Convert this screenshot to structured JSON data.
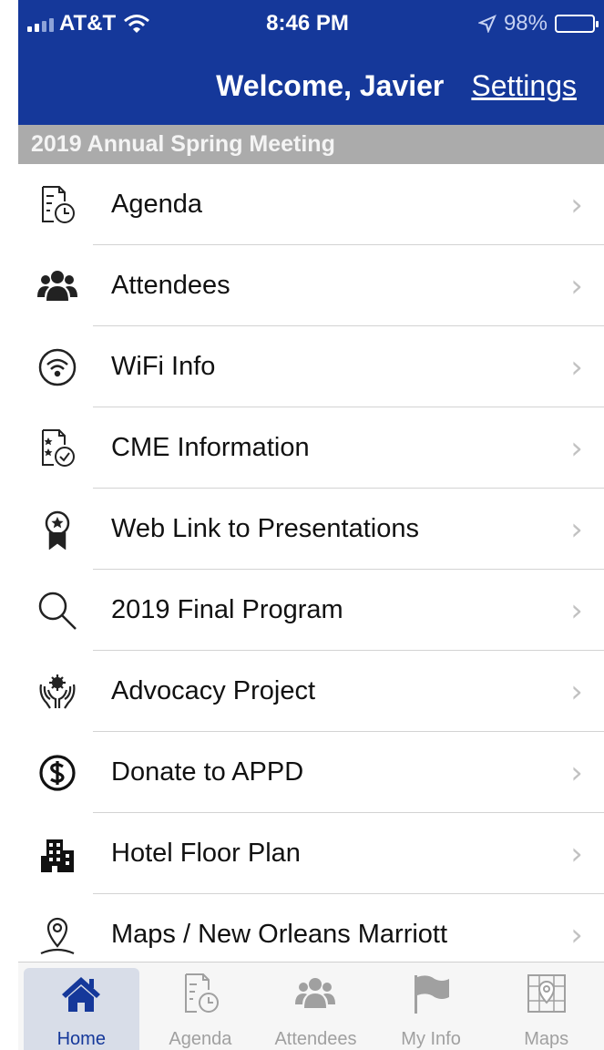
{
  "status": {
    "carrier": "AT&T",
    "time": "8:46 PM",
    "battery": "98%"
  },
  "header": {
    "welcome": "Welcome, Javier",
    "settings": "Settings"
  },
  "section": {
    "title": "2019 Annual Spring Meeting"
  },
  "menu": [
    {
      "label": "Agenda",
      "icon": "agenda-icon"
    },
    {
      "label": "Attendees",
      "icon": "people-icon"
    },
    {
      "label": "WiFi Info",
      "icon": "wifi-icon"
    },
    {
      "label": "CME Information",
      "icon": "certificate-icon"
    },
    {
      "label": "Web Link to Presentations",
      "icon": "award-icon"
    },
    {
      "label": "2019 Final Program",
      "icon": "search-icon"
    },
    {
      "label": "Advocacy Project",
      "icon": "hands-gear-icon"
    },
    {
      "label": "Donate to APPD",
      "icon": "dollar-icon"
    },
    {
      "label": "Hotel Floor Plan",
      "icon": "building-icon"
    },
    {
      "label": "Maps / New Orleans Marriott",
      "icon": "map-pin-icon"
    }
  ],
  "tabs": [
    {
      "label": "Home",
      "icon": "home-icon",
      "active": true
    },
    {
      "label": "Agenda",
      "icon": "agenda-icon",
      "active": false
    },
    {
      "label": "Attendees",
      "icon": "people-icon",
      "active": false
    },
    {
      "label": "My Info",
      "icon": "flag-icon",
      "active": false
    },
    {
      "label": "Maps",
      "icon": "map-icon",
      "active": false
    }
  ],
  "colors": {
    "brand": "#15389a",
    "section_bg": "#ababab",
    "tab_active": "#15389a",
    "tab_inactive": "#a0a0a0"
  }
}
